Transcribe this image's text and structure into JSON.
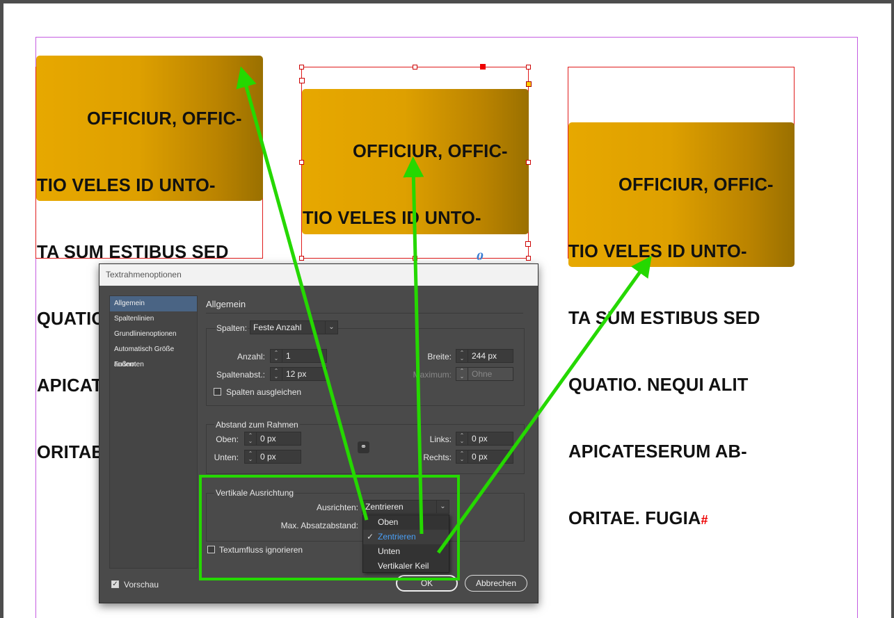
{
  "canvas": {
    "frame_text": [
      "OFFICIUR, OFFIC-",
      "TIO VELES ID UNTO-",
      "TA SUM ESTIBUS SED",
      "QUATIO. NEQUI ALIT",
      "APICATESERUM AB-",
      "ORITAE. FUGIA"
    ],
    "end_mark": "#",
    "overset_glyph": "~",
    "pin_glyph": "0"
  },
  "dialog": {
    "title": "Textrahmenoptionen",
    "sidebar": [
      "Allgemein",
      "Spaltenlinien",
      "Grundlinienoptionen",
      "Automatisch Größe ändern",
      "Fußnoten"
    ],
    "section_title": "Allgemein",
    "columns": {
      "spalten_label": "Spalten:",
      "spalten_value": "Feste Anzahl",
      "anzahl_label": "Anzahl:",
      "anzahl_value": "1",
      "spaltenabst_label": "Spaltenabst.:",
      "spaltenabst_value": "12 px",
      "breite_label": "Breite:",
      "breite_value": "244 px",
      "maximum_label": "Maximum:",
      "maximum_value": "Ohne",
      "ausgleichen_label": "Spalten ausgleichen"
    },
    "inset": {
      "title": "Abstand zum Rahmen",
      "oben_label": "Oben:",
      "oben_value": "0 px",
      "unten_label": "Unten:",
      "unten_value": "0 px",
      "links_label": "Links:",
      "links_value": "0 px",
      "rechts_label": "Rechts:",
      "rechts_value": "0 px"
    },
    "vertical": {
      "title": "Vertikale Ausrichtung",
      "ausrichten_label": "Ausrichten:",
      "ausrichten_value": "Zentrieren",
      "max_label": "Max. Absatzabstand:",
      "options": [
        "Oben",
        "Zentrieren",
        "Unten",
        "Vertikaler Keil"
      ],
      "selected_index": 1
    },
    "textumfluss_label": "Textumfluss ignorieren",
    "vorschau_label": "Vorschau",
    "vorschau_checked": true,
    "ok_label": "OK",
    "cancel_label": "Abbrechen"
  },
  "colors": {
    "annotation_green": "#25d800",
    "frame_red": "#e01a1a",
    "margin_purple": "#c45be0",
    "selection_blue": "#4a9ff5"
  }
}
